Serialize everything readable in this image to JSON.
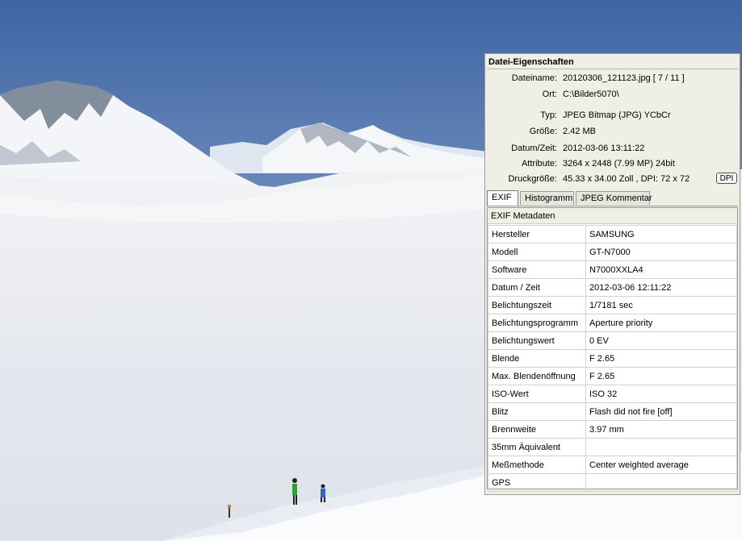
{
  "panel": {
    "title": "Datei-Eigenschaften",
    "properties": [
      {
        "label": "Dateiname:",
        "value": "20120306_121123.jpg   [ 7 / 11 ]"
      },
      {
        "label": "Ort:",
        "value": "C:\\Bilder5070\\"
      },
      {
        "label": "Typ:",
        "value": "JPEG Bitmap (JPG) YCbCr"
      },
      {
        "label": "Größe:",
        "value": "2.42 MB"
      },
      {
        "label": "Datum/Zeit:",
        "value": "2012-03-06 13:11:22"
      },
      {
        "label": "Attribute:",
        "value": "3264 x 2448 (7.99 MP)  24bit"
      },
      {
        "label": "Druckgröße:",
        "value": "45.33 x 34.00 Zoll ,   DPI: 72 x 72"
      }
    ],
    "dpi_button": "DPI",
    "tabs": [
      "EXIF",
      "Histogramm",
      "JPEG Kommentar"
    ],
    "active_tab": "EXIF",
    "exif": {
      "header": "EXIF Metadaten",
      "rows": [
        {
          "key": "Hersteller",
          "value": "SAMSUNG"
        },
        {
          "key": "Modell",
          "value": "GT-N7000"
        },
        {
          "key": "Software",
          "value": "N7000XXLA4"
        },
        {
          "key": "Datum / Zeit",
          "value": "2012-03-06 12:11:22"
        },
        {
          "key": "Belichtungszeit",
          "value": "1/7181 sec"
        },
        {
          "key": "Belichtungsprogramm",
          "value": "Aperture priority"
        },
        {
          "key": "Belichtungswert",
          "value": "0 EV"
        },
        {
          "key": "Blende",
          "value": "F 2.65"
        },
        {
          "key": "Max. Blendenöffnung",
          "value": "F 2.65"
        },
        {
          "key": "ISO-Wert",
          "value": "ISO 32"
        },
        {
          "key": "Blitz",
          "value": "Flash did not fire [off]"
        },
        {
          "key": "Brennweite",
          "value": "3.97 mm"
        },
        {
          "key": "35mm Äquivalent",
          "value": ""
        },
        {
          "key": "Meßmethode",
          "value": "Center weighted average"
        },
        {
          "key": "GPS",
          "value": ""
        }
      ]
    }
  },
  "colors": {
    "sky_top": "#3f65a3",
    "sky_bottom": "#c4d3e6",
    "fog": "#e9ecf1",
    "panel_bg": "#f0efe6"
  }
}
